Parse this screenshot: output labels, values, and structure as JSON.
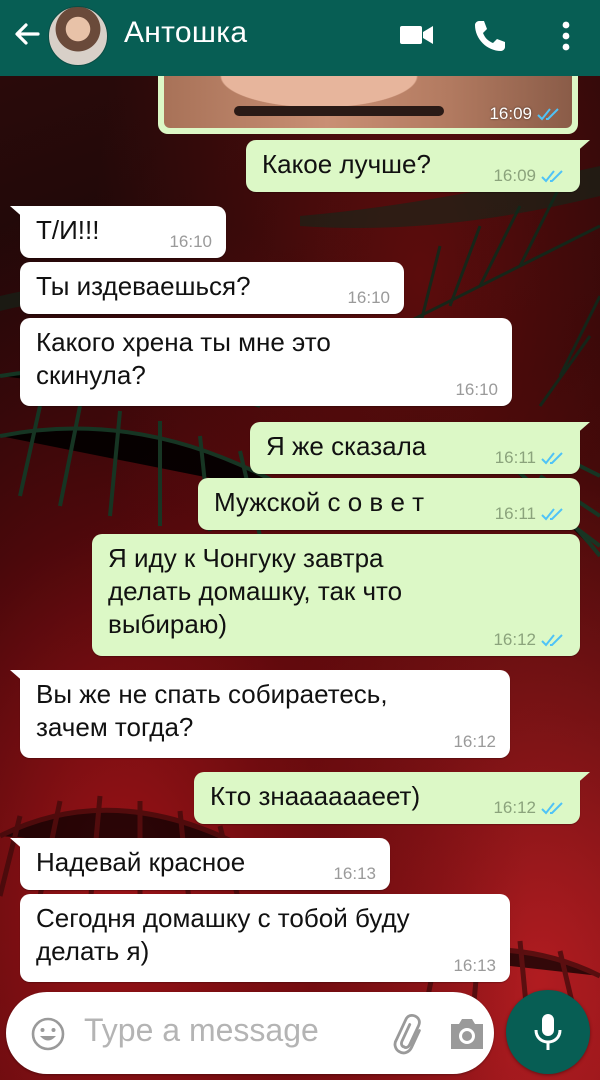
{
  "header": {
    "contact_name": "Антошка",
    "bg_color": "#075e54"
  },
  "image_message": {
    "time": "16:09",
    "status": "read"
  },
  "messages": [
    {
      "dir": "out",
      "lines": [
        "Какое лучше?"
      ],
      "time": "16:09",
      "status": "read"
    },
    {
      "dir": "in",
      "lines": [
        "Т/И!!!"
      ],
      "time": "16:10"
    },
    {
      "dir": "in",
      "lines": [
        "Ты издеваешься?"
      ],
      "time": "16:10"
    },
    {
      "dir": "in",
      "lines": [
        "Какого хрена ты мне это",
        "скинула?"
      ],
      "time": "16:10"
    },
    {
      "dir": "out",
      "lines": [
        "Я же сказала"
      ],
      "time": "16:11",
      "status": "read"
    },
    {
      "dir": "out",
      "lines": [
        "Мужской с о в е т"
      ],
      "time": "16:11",
      "status": "read"
    },
    {
      "dir": "out",
      "lines": [
        "Я иду к Чонгуку завтра",
        "делать домашку, так что",
        "выбираю)"
      ],
      "time": "16:12",
      "status": "read"
    },
    {
      "dir": "in",
      "lines": [
        "Вы же не спать собираетесь,",
        "зачем тогда?"
      ],
      "time": "16:12"
    },
    {
      "dir": "out",
      "lines": [
        "Кто знааааааеет)"
      ],
      "time": "16:12",
      "status": "read"
    },
    {
      "dir": "in",
      "lines": [
        "Надевай красное"
      ],
      "time": "16:13"
    },
    {
      "dir": "in",
      "lines": [
        "Сегодня домашку с тобой буду",
        "делать я)"
      ],
      "time": "16:13"
    }
  ],
  "input": {
    "placeholder": "Type a message"
  },
  "colors": {
    "incoming": "#ffffff",
    "outgoing": "#dcf8c6",
    "read_ticks": "#4fc3f7",
    "accent": "#075e54"
  },
  "icons": [
    "back-arrow-icon",
    "video-call-icon",
    "phone-icon",
    "more-vert-icon",
    "emoji-icon",
    "attach-icon",
    "camera-icon",
    "mic-icon"
  ]
}
